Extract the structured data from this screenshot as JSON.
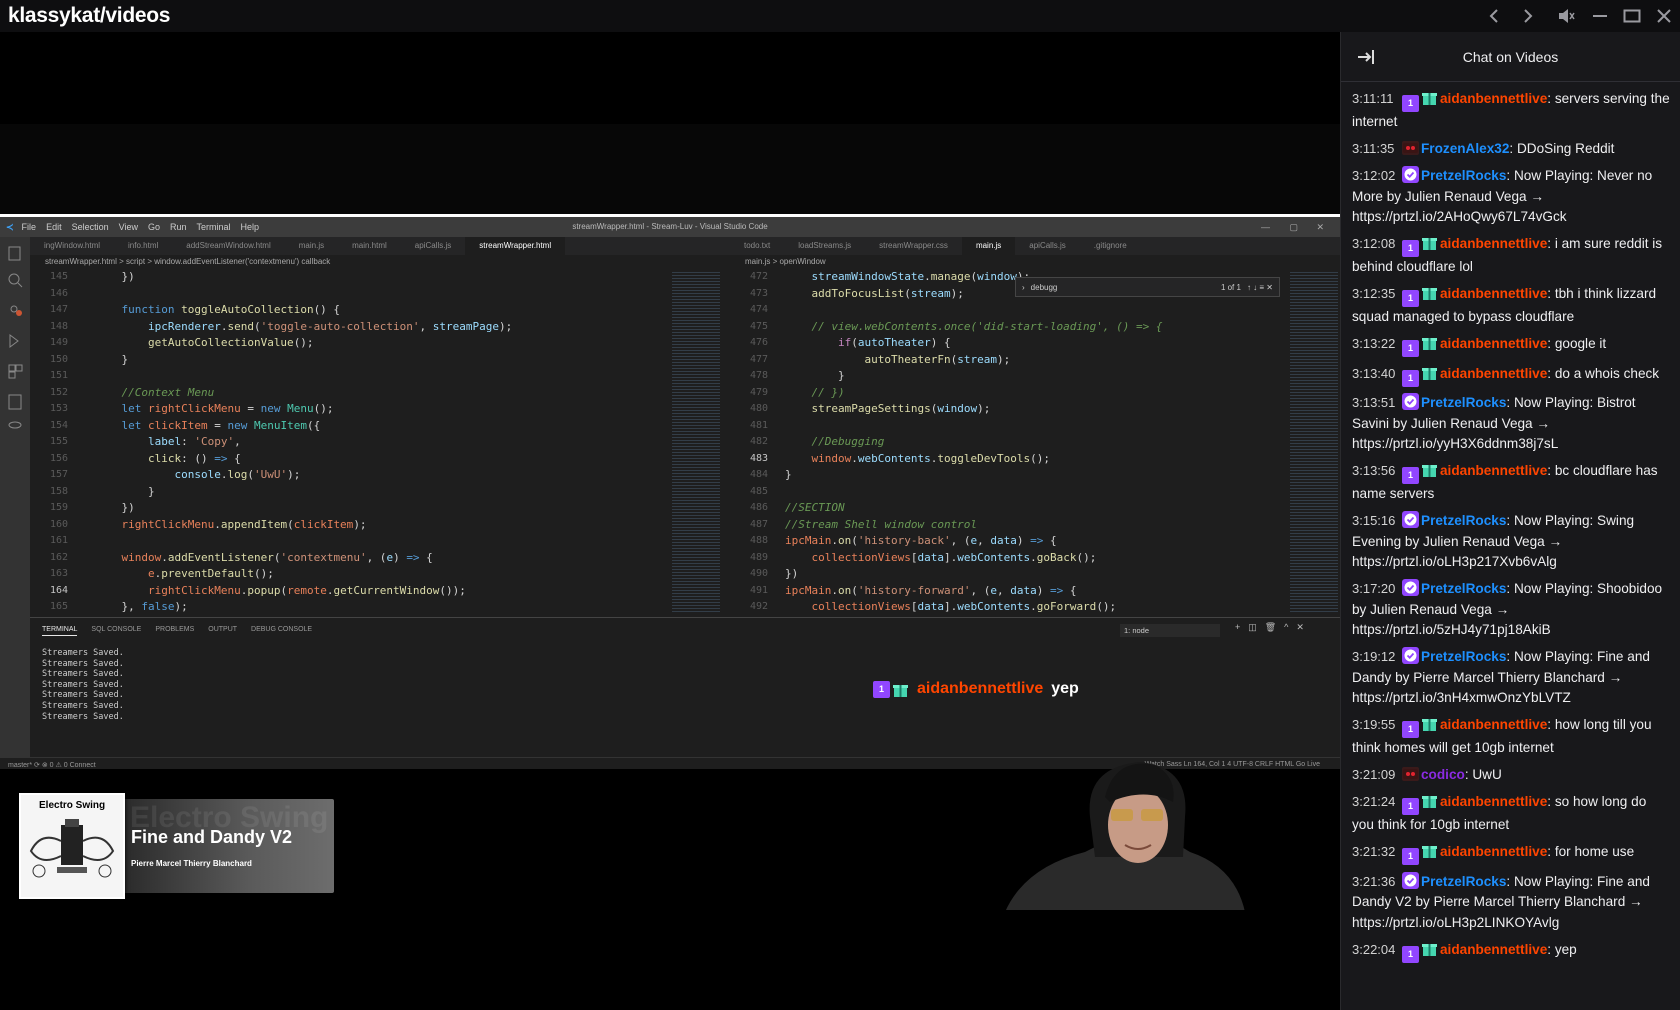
{
  "window": {
    "title": "klassykat/videos"
  },
  "vscode": {
    "menu": [
      "File",
      "Edit",
      "Selection",
      "View",
      "Go",
      "Run",
      "Terminal",
      "Help"
    ],
    "title": "streamWrapper.html - Stream-Luv - Visual Studio Code",
    "left_tabs": [
      "ingWindow.html",
      "info.html",
      "addStreamWindow.html",
      "main.js",
      "main.html",
      "apiCalls.js",
      "streamWrapper.html"
    ],
    "right_tabs": [
      "todo.txt",
      "loadStreams.js",
      "streamWrapper.css",
      "main.js",
      "apiCalls.js",
      ".gitignore"
    ],
    "left_breadcrumb": "streamWrapper.html > script > window.addEventListener('contextmenu') callback",
    "right_breadcrumb": "main.js > openWindow",
    "find_query": "debugg",
    "find_count": "1 of 1",
    "panel_tabs": [
      "TERMINAL",
      "SQL CONSOLE",
      "PROBLEMS",
      "OUTPUT",
      "DEBUG CONSOLE"
    ],
    "terminal_select": "1: node",
    "terminal_lines": [
      "Streamers Saved.",
      "Streamers Saved.",
      "Streamers Saved.",
      "Streamers Saved.",
      "Streamers Saved.",
      "Streamers Saved.",
      "Streamers Saved."
    ],
    "status_left": "master*    ⟳    ⊗ 0 ⚠ 0    Connect",
    "status_right": "Watch Sass    Ln 164, Col 1    4    UTF-8    CRLF    HTML    Go Live"
  },
  "overlay_chat": {
    "user": "aidanbennettlive",
    "text": "yep"
  },
  "now_playing": {
    "genre": "Electro Swing",
    "ghost_text": "Electro Swing",
    "title": "Fine and Dandy V2",
    "artist": "Pierre Marcel Thierry Blanchard"
  },
  "chat": {
    "title": "Chat on Videos",
    "messages": [
      {
        "ts": "3:11:11",
        "badges": [
          "sub",
          "gift"
        ],
        "user": "aidanbennettlive",
        "color": "#ff4500",
        "text": ": servers serving the internet"
      },
      {
        "ts": "3:11:35",
        "badges": [
          "red"
        ],
        "user": "FrozenAlex32",
        "color": "#1e90ff",
        "text": ": DDoSing Reddit"
      },
      {
        "ts": "3:12:02",
        "badges": [
          "verified"
        ],
        "user": "PretzelRocks",
        "color": "#1e90ff",
        "text": ": Now Playing: Never no More by Julien Renaud Vega → https://prtzl.io/2AHoQwy67L74vGck"
      },
      {
        "ts": "3:12:08",
        "badges": [
          "sub",
          "gift"
        ],
        "user": "aidanbennettlive",
        "color": "#ff4500",
        "text": ": i am sure reddit is behind cloudflare lol"
      },
      {
        "ts": "3:12:35",
        "badges": [
          "sub",
          "gift"
        ],
        "user": "aidanbennettlive",
        "color": "#ff4500",
        "text": ": tbh i think lizzard squad managed to bypass cloudflare"
      },
      {
        "ts": "3:13:22",
        "badges": [
          "sub",
          "gift"
        ],
        "user": "aidanbennettlive",
        "color": "#ff4500",
        "text": ": google it"
      },
      {
        "ts": "3:13:40",
        "badges": [
          "sub",
          "gift"
        ],
        "user": "aidanbennettlive",
        "color": "#ff4500",
        "text": ": do a whois check"
      },
      {
        "ts": "3:13:51",
        "badges": [
          "verified"
        ],
        "user": "PretzelRocks",
        "color": "#1e90ff",
        "text": ": Now Playing: Bistrot Savini by Julien Renaud Vega → https://prtzl.io/yyH3X6ddnm38j7sL"
      },
      {
        "ts": "3:13:56",
        "badges": [
          "sub",
          "gift"
        ],
        "user": "aidanbennettlive",
        "color": "#ff4500",
        "text": ": bc cloudflare has name servers"
      },
      {
        "ts": "3:15:16",
        "badges": [
          "verified"
        ],
        "user": "PretzelRocks",
        "color": "#1e90ff",
        "text": ": Now Playing: Swing Evening by Julien Renaud Vega → https://prtzl.io/oLH3p217Xvb6vAlg"
      },
      {
        "ts": "3:17:20",
        "badges": [
          "verified"
        ],
        "user": "PretzelRocks",
        "color": "#1e90ff",
        "text": ": Now Playing: Shoobidoo by Julien Renaud Vega → https://prtzl.io/5zHJ4y71pj18AkiB"
      },
      {
        "ts": "3:19:12",
        "badges": [
          "verified"
        ],
        "user": "PretzelRocks",
        "color": "#1e90ff",
        "text": ": Now Playing: Fine and Dandy by Pierre Marcel Thierry Blanchard → https://prtzl.io/3nH4xmwOnzYbLVTZ"
      },
      {
        "ts": "3:19:55",
        "badges": [
          "sub",
          "gift"
        ],
        "user": "aidanbennettlive",
        "color": "#ff4500",
        "text": ": how long till you think homes will get 10gb internet"
      },
      {
        "ts": "3:21:09",
        "badges": [
          "red"
        ],
        "user": "codico",
        "color": "#8a2be2",
        "text": ": UwU"
      },
      {
        "ts": "3:21:24",
        "badges": [
          "sub",
          "gift"
        ],
        "user": "aidanbennettlive",
        "color": "#ff4500",
        "text": ": so how long do you think for 10gb internet"
      },
      {
        "ts": "3:21:32",
        "badges": [
          "sub",
          "gift"
        ],
        "user": "aidanbennettlive",
        "color": "#ff4500",
        "text": ": for home use"
      },
      {
        "ts": "3:21:36",
        "badges": [
          "verified"
        ],
        "user": "PretzelRocks",
        "color": "#1e90ff",
        "text": ": Now Playing: Fine and Dandy V2 by Pierre Marcel Thierry Blanchard → https://prtzl.io/oLH3p2LINKOYAvlg"
      },
      {
        "ts": "3:22:04",
        "badges": [
          "sub",
          "gift"
        ],
        "user": "aidanbennettlive",
        "color": "#ff4500",
        "text": ": yep"
      }
    ]
  }
}
